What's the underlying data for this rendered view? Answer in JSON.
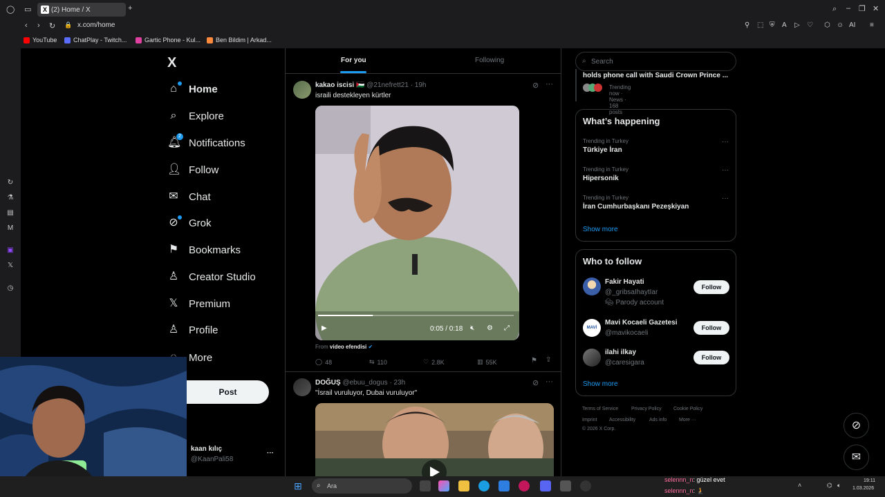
{
  "browser": {
    "tab_title": "(2) Home / X",
    "tab_favicon": "X",
    "url": "x.com/home",
    "bookmarks": [
      {
        "label": "YouTube",
        "color": "#ff0000"
      },
      {
        "label": "ChatPlay - Twitch...",
        "color": "#5b6dff"
      },
      {
        "label": "Gartic Phone - Kul...",
        "color": "#e040a0"
      },
      {
        "label": "Ben Bildim | Arkad...",
        "color": "#ff8a3d"
      }
    ],
    "ai_label": "AI"
  },
  "nav": {
    "logo": "X",
    "items": [
      {
        "label": "Home",
        "icon": "home-icon",
        "active": true
      },
      {
        "label": "Explore",
        "icon": "search-icon"
      },
      {
        "label": "Notifications",
        "icon": "bell-icon",
        "badge": "2"
      },
      {
        "label": "Follow",
        "icon": "add-user-icon"
      },
      {
        "label": "Chat",
        "icon": "mail-icon"
      },
      {
        "label": "Grok",
        "icon": "grok-icon"
      },
      {
        "label": "Bookmarks",
        "icon": "bookmark-icon"
      },
      {
        "label": "Creator Studio",
        "icon": "creator-icon"
      },
      {
        "label": "Premium",
        "icon": "x-icon"
      },
      {
        "label": "Profile",
        "icon": "person-icon"
      },
      {
        "label": "More",
        "icon": "more-icon"
      }
    ],
    "post_button": "Post",
    "account": {
      "name": "kaan kılıç",
      "handle": "@KaanPali58"
    }
  },
  "feed": {
    "tabs": [
      "For you",
      "Following"
    ],
    "tweets": [
      {
        "name": "kakao iscisi",
        "flag": "🇵🇸",
        "handle": "@21nefrett21",
        "time": "· 19h",
        "text": "israili destekleyen kürtler",
        "video_time": "0:05 / 0:18",
        "progress": 0.28,
        "from_label": "From",
        "from_account": "video efendisi",
        "stats": {
          "replies": "48",
          "reposts": "110",
          "likes": "2.8K",
          "views": "55K"
        }
      },
      {
        "name": "DOĞUŞ",
        "handle": "@ebuu_dogus",
        "time": "· 23h",
        "text": "\"İsrail vuruluyor, Dubai vuruluyor\""
      }
    ]
  },
  "sidebar": {
    "search_placeholder": "Search",
    "top_story": {
      "title": "holds phone call with Saudi Crown Prince ...",
      "meta": "Trending now · News · 168 posts"
    },
    "whats_happening": {
      "title": "What’s happening",
      "trends": [
        {
          "context": "Trending in Turkey",
          "name": "Türkiye İran"
        },
        {
          "context": "Trending in Turkey",
          "name": "Hipersonik"
        },
        {
          "context": "Trending in Turkey",
          "name": "İran Cumhurbaşkanı Pezeşkiyan"
        }
      ],
      "show_more": "Show more"
    },
    "who_to_follow": {
      "title": "Who to follow",
      "accounts": [
        {
          "name": "Fakir Hayati",
          "handle": "@_gribsaIhaytIar",
          "note": "Parody account",
          "button": "Follow"
        },
        {
          "name": "Mavi Kocaeli Gazetesi",
          "handle": "@mavikocaeli",
          "button": "Follow"
        },
        {
          "name": "ilahi ilkay",
          "handle": "@caresigara",
          "button": "Follow"
        }
      ],
      "show_more": "Show more"
    },
    "footer": {
      "links": [
        "Terms of Service",
        "Privacy Policy",
        "Cookie Policy",
        "Imprint",
        "Accessibility",
        "Ads info",
        "More ···"
      ],
      "copyright": "© 2026 X Corp."
    }
  },
  "taskbar": {
    "search_placeholder": "Ara",
    "chat": [
      {
        "user": "selennn_n",
        "msg": ": güzel evet"
      },
      {
        "user": "selennn_n",
        "msg": ": 🧎"
      }
    ],
    "time": "19:11",
    "date": "1.03.2026"
  },
  "colors": {
    "accent": "#1d9bf0",
    "background": "#000000",
    "border": "#2f3336",
    "muted": "#71767b"
  }
}
